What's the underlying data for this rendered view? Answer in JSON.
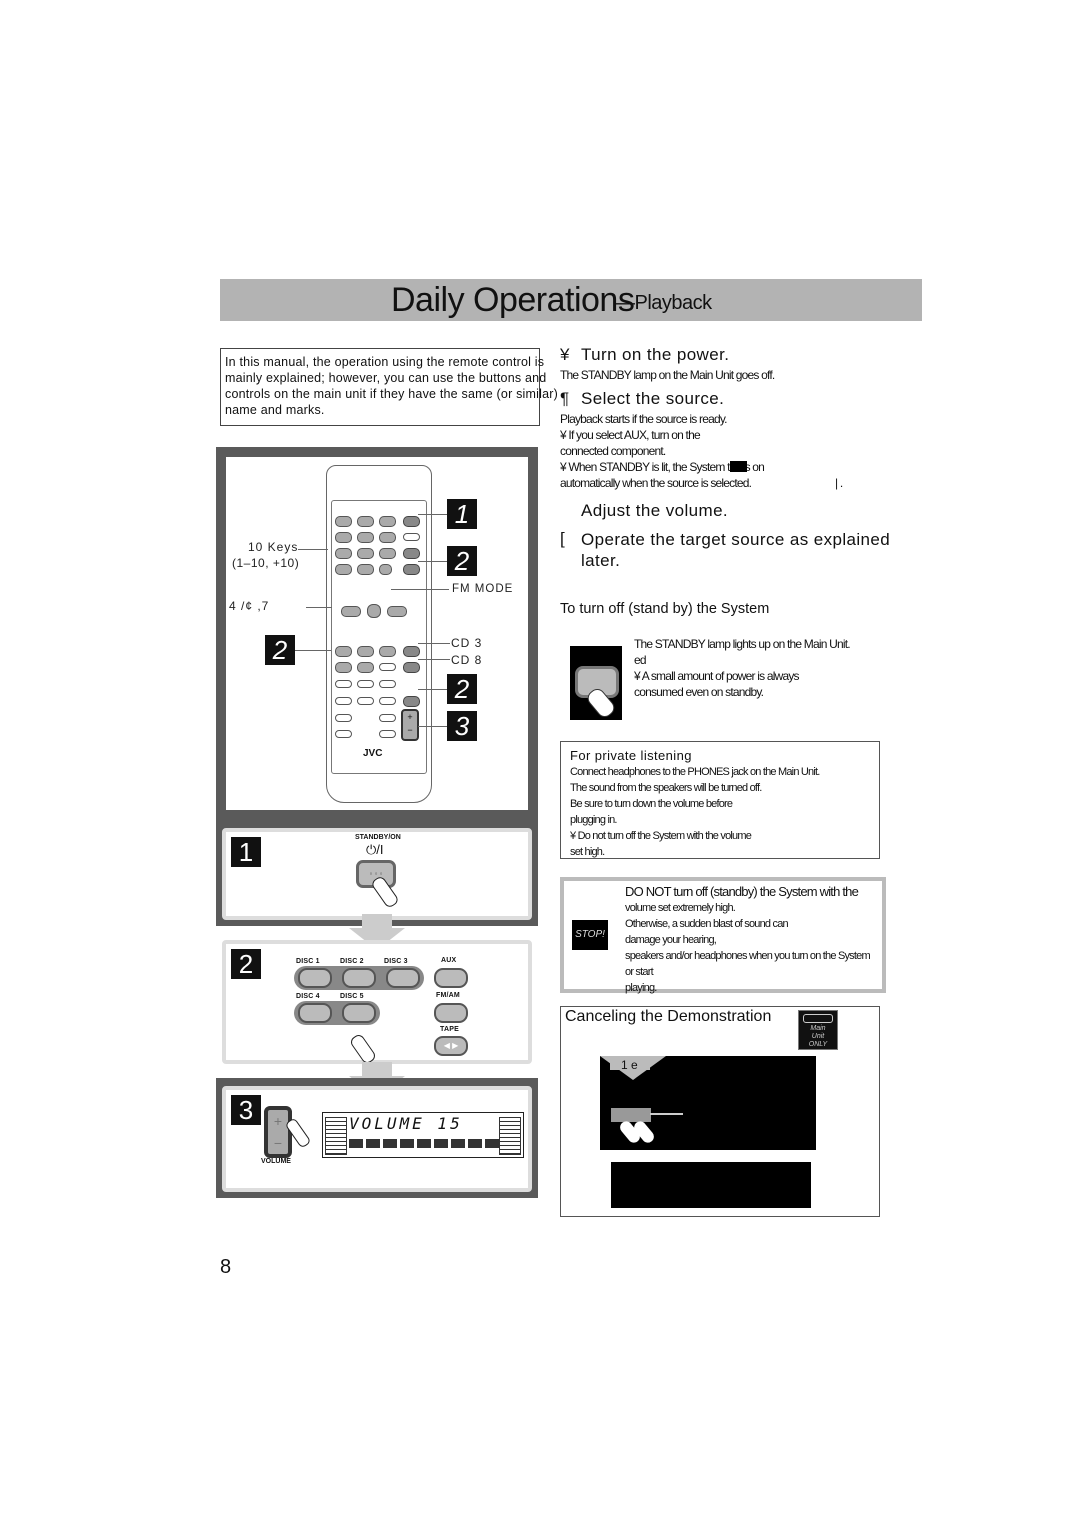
{
  "page": {
    "title": "Daily Operations",
    "title_sub": "—Playback",
    "page_number": "8"
  },
  "intro": {
    "text": "In this manual, the operation using the remote control is mainly explained; however, you can use the buttons and controls on the main unit if they have the same (or similar) name and marks."
  },
  "steps": [
    {
      "symbol": "¥",
      "heading": "Turn on the power.",
      "body": [
        "The STANDBY lamp on the Main Unit goes off."
      ]
    },
    {
      "symbol": "¶",
      "heading": "Select the source.",
      "body": [
        "Playback starts if the source is ready.",
        "¥ If you select AUX, turn on the",
        "  connected component.",
        "¥ When STANDBY is lit, the System turns on",
        "  automatically when the source is selected."
      ],
      "suffix": "| ."
    },
    {
      "symbol": "",
      "heading": "Adjust the volume.",
      "body": []
    },
    {
      "symbol": "[",
      "heading": "Operate the target source as explained later.",
      "body": []
    }
  ],
  "standby_section": {
    "heading": "To turn off (stand by) the System",
    "body": [
      "The STANDBY lamp lights up on the Main Unit.",
      "ed",
      "¥ A small amount of power is always",
      "  consumed even on standby."
    ]
  },
  "private_listening": {
    "heading": "For private listening",
    "body": [
      "Connect headphones to the PHONES jack on the Main Unit.",
      "The sound from the speakers will be turned off.",
      "Be sure to turn down the volume before",
      "plugging in.",
      "¥ Do not turn off the System with the volume",
      "  set high."
    ]
  },
  "caution": {
    "icon_label": "STOP!",
    "body": [
      "DO NOT turn off (standby) the System with the",
      "volume set extremely high.",
      "Otherwise, a sudden blast of sound can",
      "damage your hearing,",
      "speakers and/or headphones when you turn on the System or start",
      "playing."
    ]
  },
  "demo": {
    "heading": "Canceling the Demonstration",
    "badge": "Main Unit ONLY",
    "step_label": "1 e"
  },
  "remote": {
    "labels": {
      "ten_key": "10 Keys",
      "ten_key_sub": "(1–10, +10)",
      "fm_mode": "FM MODE",
      "transport": "4    /¢    ,7",
      "cd3": "CD 3",
      "cd8": "CD 8",
      "brand": "JVC"
    },
    "tags": [
      "1",
      "2",
      "2",
      "2",
      "3"
    ]
  },
  "step_panels": {
    "panel1": {
      "num": "1",
      "label": "STANDBY/ON",
      "symbol": "⏻/I"
    },
    "panel2": {
      "num": "2",
      "discs": [
        "DISC 1",
        "DISC 2",
        "DISC 3",
        "DISC 4",
        "DISC 5"
      ],
      "aux": "AUX",
      "fmam": "FM/AM",
      "tape": "TAPE"
    },
    "panel3": {
      "num": "3",
      "volume_label": "VOLUME",
      "display_text": "VOLUME  15"
    }
  }
}
